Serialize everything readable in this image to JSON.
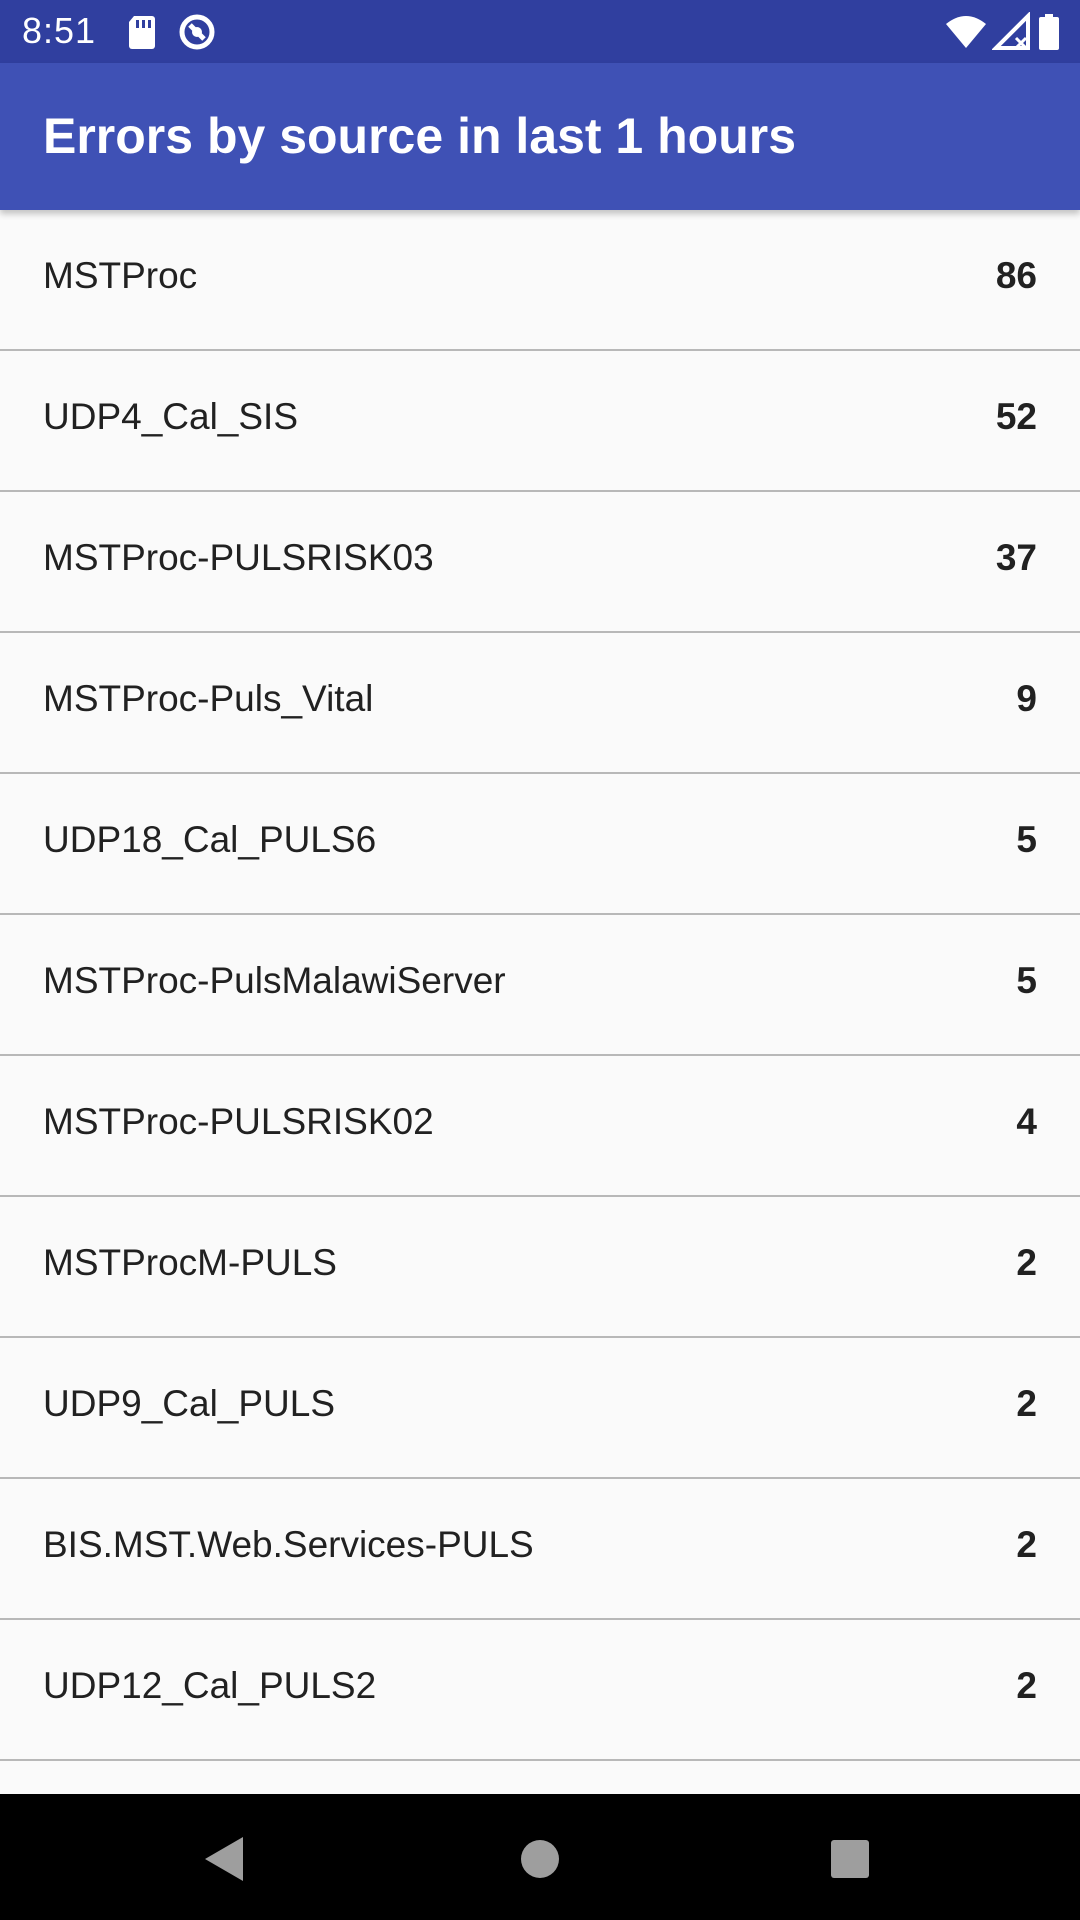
{
  "status_bar": {
    "time": "8:51",
    "icons": [
      "sd-card-icon",
      "data-saver-icon",
      "wifi-icon",
      "cellular-signal-icon",
      "battery-icon"
    ]
  },
  "app_bar": {
    "title": "Errors by source in last 1 hours",
    "color": "#3f51b5"
  },
  "list": {
    "items": [
      {
        "source": "MSTProc",
        "count": "86"
      },
      {
        "source": "UDP4_Cal_SIS",
        "count": "52"
      },
      {
        "source": "MSTProc-PULSRISK03",
        "count": "37"
      },
      {
        "source": "MSTProc-Puls_Vital",
        "count": "9"
      },
      {
        "source": "UDP18_Cal_PULS6",
        "count": "5"
      },
      {
        "source": "MSTProc-PulsMalawiServer",
        "count": "5"
      },
      {
        "source": "MSTProc-PULSRISK02",
        "count": "4"
      },
      {
        "source": "MSTProcM-PULS",
        "count": "2"
      },
      {
        "source": "UDP9_Cal_PULS",
        "count": "2"
      },
      {
        "source": "BIS.MST.Web.Services-PULS",
        "count": "2"
      },
      {
        "source": "UDP12_Cal_PULS2",
        "count": "2"
      }
    ]
  },
  "nav_bar": {
    "buttons": [
      "back-icon",
      "home-icon",
      "recents-icon"
    ]
  }
}
